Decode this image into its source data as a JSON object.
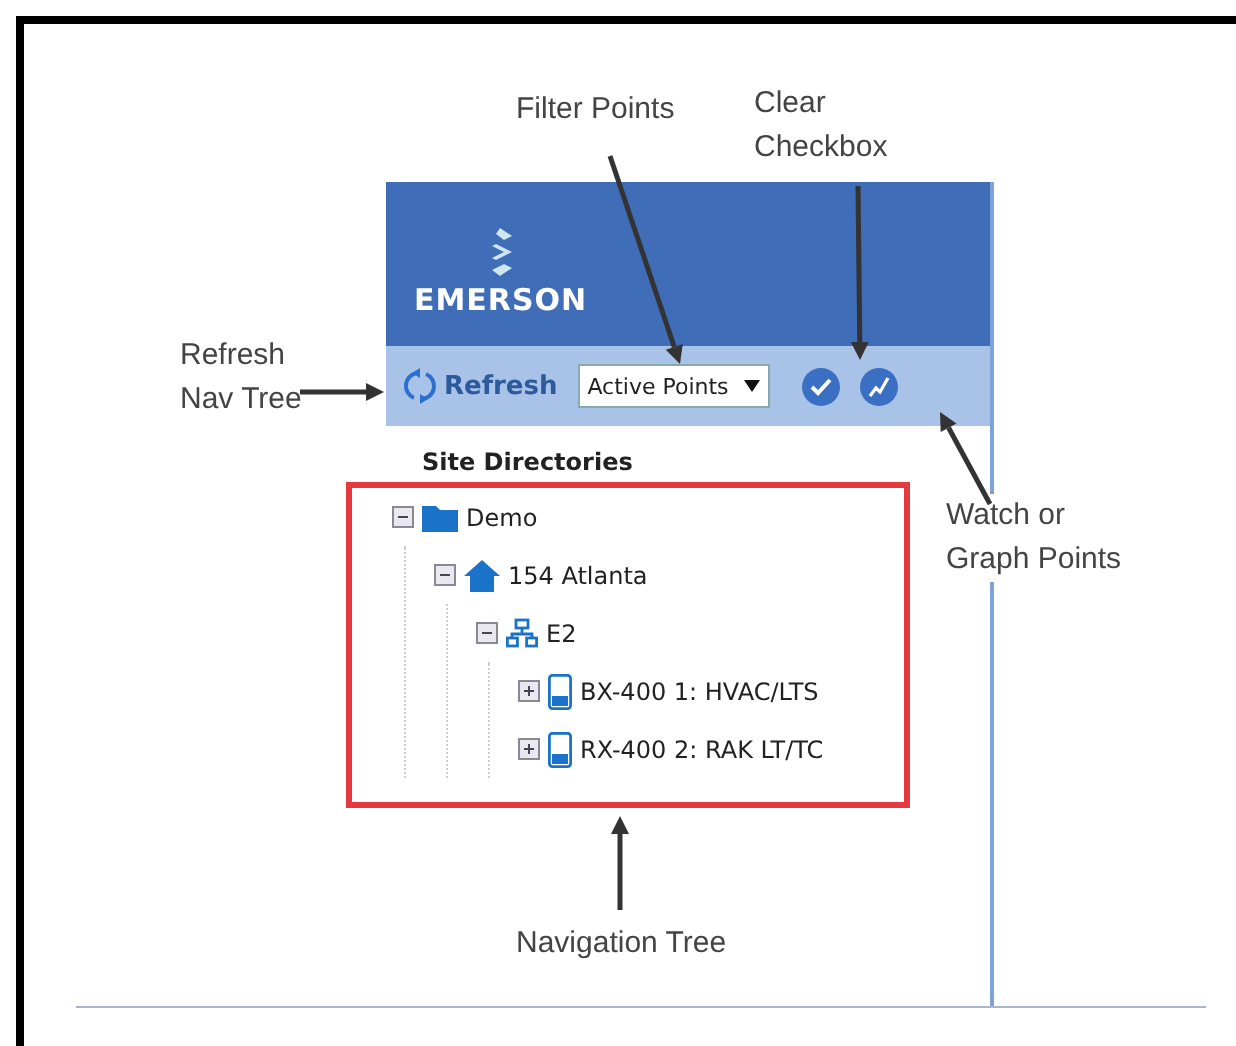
{
  "callouts": [
    {
      "kind": "filter",
      "lines": [
        "Filter Points"
      ]
    },
    {
      "kind": "clear",
      "lines": [
        "Clear",
        "Checkbox"
      ]
    },
    {
      "kind": "refresh",
      "lines": [
        "Refresh",
        "Nav Tree"
      ]
    },
    {
      "kind": "watch",
      "lines": [
        "Watch or",
        "Graph Points"
      ]
    },
    {
      "kind": "tree",
      "lines": [
        "Navigation Tree"
      ]
    }
  ],
  "panel": {
    "logo": "EMERSON",
    "toolbar": {
      "refresh": "Refresh",
      "filter": {
        "value": "Active Points"
      }
    },
    "heading": "Site Directories",
    "tree": [
      {
        "label": "Demo",
        "kind": "folder",
        "expanded": true,
        "children": [
          {
            "label": "154 Atlanta",
            "kind": "site",
            "expanded": true,
            "children": [
              {
                "label": "E2",
                "kind": "network",
                "expanded": true,
                "children": [
                  {
                    "label": "BX-400 1: HVAC/LTS",
                    "kind": "controller",
                    "expanded": false
                  },
                  {
                    "label": "RX-400 2: RAK LT/TC",
                    "kind": "controller",
                    "expanded": false
                  }
                ]
              }
            ]
          }
        ]
      }
    ]
  }
}
